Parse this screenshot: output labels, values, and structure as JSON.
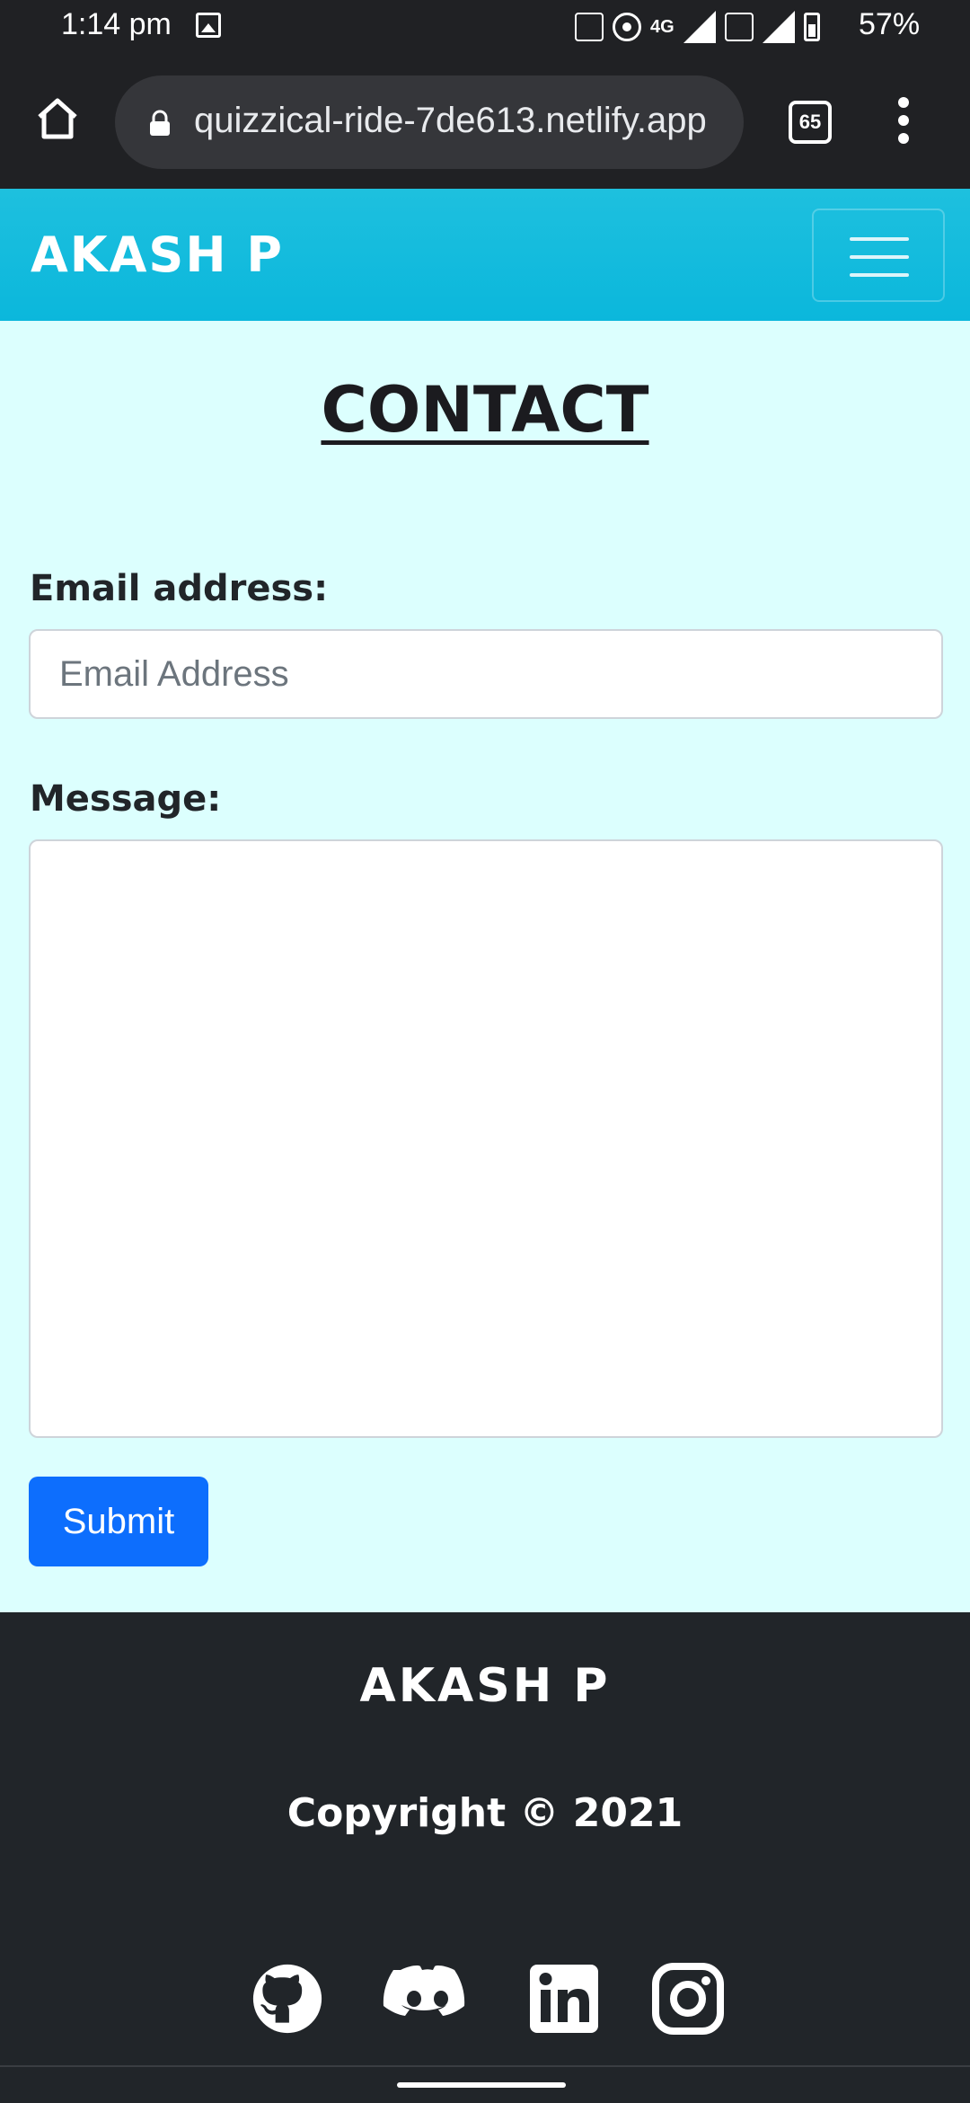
{
  "status_bar": {
    "time": "1:14 pm",
    "network": "4G",
    "sim1": "1",
    "sim2": "2",
    "battery": "57%"
  },
  "browser": {
    "url": "quizzical-ride-7de613.netlify.app",
    "tab_count": "65"
  },
  "navbar": {
    "brand": "AKASH P"
  },
  "contact": {
    "title": "CONTACT",
    "email_label": "Email address:",
    "email_placeholder": "Email Address",
    "email_value": "",
    "message_label": "Message:",
    "message_value": "",
    "submit_label": "Submit"
  },
  "footer": {
    "name": "AKASH P",
    "copyright": "Copyright © 2021",
    "social": [
      "github-icon",
      "discord-icon",
      "linkedin-icon",
      "instagram-icon"
    ]
  },
  "colors": {
    "navbar": "#0bb7dc",
    "page_bg": "#dcfffe",
    "submit": "#0d6efd",
    "footer": "#212529"
  }
}
